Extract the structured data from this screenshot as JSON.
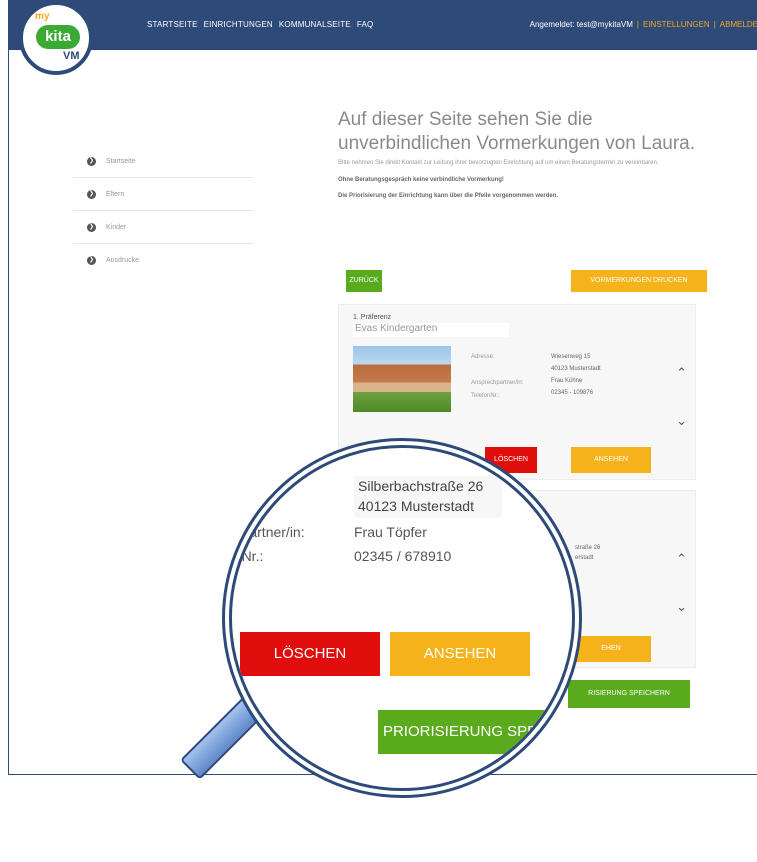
{
  "nav": {
    "items": [
      "STARTSEITE",
      "EINRICHTUNGEN",
      "KOMMUNALSEITE",
      "FAQ"
    ],
    "logged_in_label": "Angemeldet: test@mykitaVM",
    "settings": "EINSTELLUNGEN",
    "logout": "ABMELDE"
  },
  "logo": {
    "my": "my",
    "kita": "kita",
    "vm": "VM"
  },
  "sidebar": {
    "items": [
      {
        "label": "Startseite"
      },
      {
        "label": "Eltern"
      },
      {
        "label": "Kinder"
      },
      {
        "label": "Ausdrucke"
      }
    ]
  },
  "main": {
    "headline": "Auf dieser Seite sehen Sie die unverbindlichen Vormerkungen von Laura.",
    "intro": "Bitte nehmen Sie direkt Kontakt zur Leitung ihrer bevorzugten Einrichtung auf um einen Beratungstermin zu vereinbaren.",
    "note1": "Ohne Beratungsgespräch keine verbindliche Vormerkung!",
    "note2": "Die Priorisierung der Einrichtung kann über die Pfeile vorgenommen werden.",
    "back": "ZURÜCK",
    "print": "VORMERKUNGEN DRUCKEN"
  },
  "card1": {
    "pref": "1. Präferenz",
    "name": "Evas Kindergarten",
    "labels": [
      "Adresse:",
      "Ansprechpartner/in:",
      "TelefonNr.:"
    ],
    "street": "Wiesenweg 15",
    "city": "40123 Musterstadt",
    "contact": "Frau Kühne",
    "phone": "02345 - 109876",
    "delete": "LÖSCHEN",
    "show": "ANSEHEN"
  },
  "card2": {
    "street_part": "straße 26",
    "city_part": "erstadt",
    "show_part": "EHEN",
    "save_part": "RISIERUNG SPEICHERN"
  },
  "lens": {
    "street": "Silberbachstraße 26",
    "city": "40123 Musterstadt",
    "contact_label": "nhpartner/in:",
    "contact": "Frau Töpfer",
    "phone_label": "onNr.:",
    "phone": "02345 / 678910",
    "delete": "LÖSCHEN",
    "show": "ANSEHEN",
    "save": "PRIORISIERUNG SPEICHE"
  }
}
